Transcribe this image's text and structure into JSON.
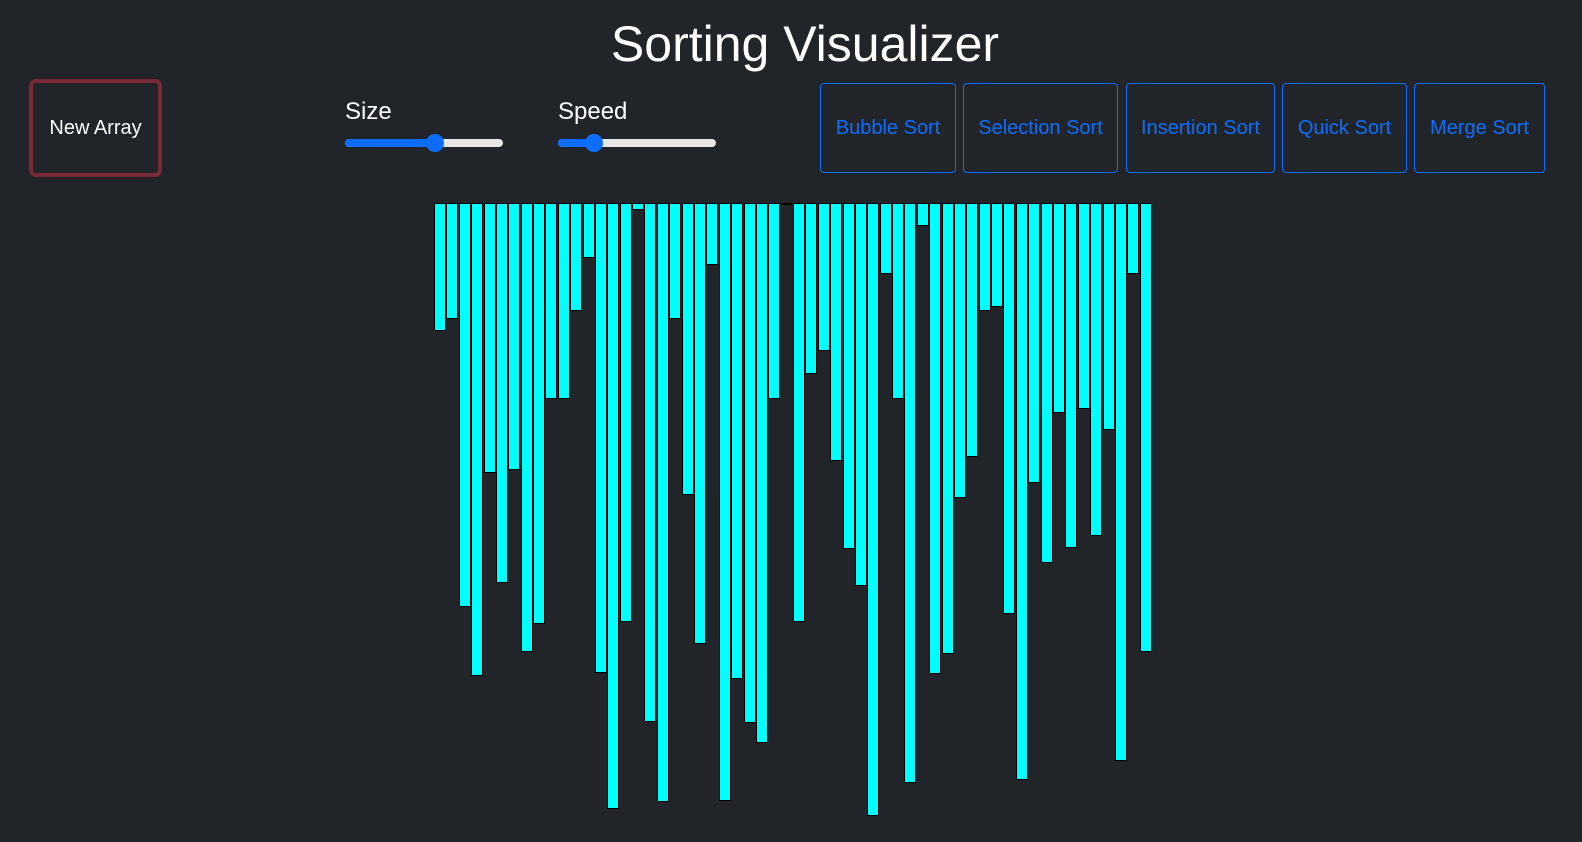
{
  "title": "Sorting Visualizer",
  "new_array_label": "New Array",
  "controls": {
    "size": {
      "label": "Size",
      "value_fraction": 0.58
    },
    "speed": {
      "label": "Speed",
      "value_fraction": 0.19
    }
  },
  "algorithms": [
    {
      "label": "Bubble Sort"
    },
    {
      "label": "Selection Sort"
    },
    {
      "label": "Insertion Sort"
    },
    {
      "label": "Quick Sort"
    },
    {
      "label": "Merge Sort"
    }
  ],
  "colors": {
    "background": "#212429",
    "bar": "#00ffff",
    "accent": "#0d6efd",
    "new_array_border": "#7a2a36"
  },
  "array_values": [
    128,
    116,
    404,
    473,
    270,
    380,
    267,
    449,
    421,
    196,
    196,
    108,
    55,
    470,
    606,
    419,
    7,
    519,
    599,
    116,
    292,
    441,
    62,
    598,
    476,
    520,
    540,
    196,
    2,
    419,
    171,
    148,
    258,
    346,
    383,
    613,
    71,
    196,
    580,
    23,
    471,
    451,
    295,
    254,
    108,
    104,
    411,
    577,
    280,
    360,
    210,
    345,
    206,
    333,
    227,
    558,
    71,
    449
  ]
}
